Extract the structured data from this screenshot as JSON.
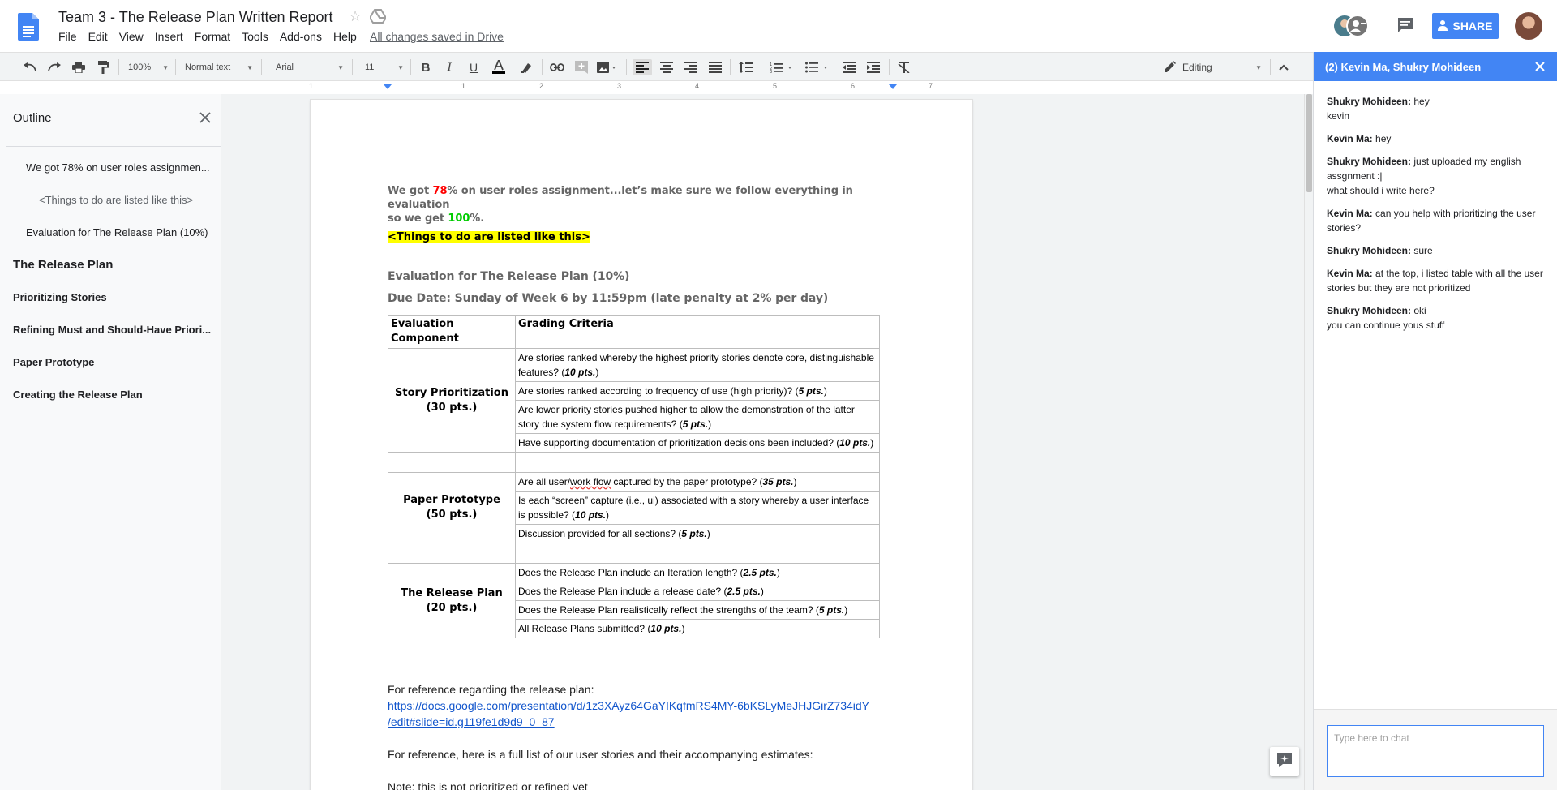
{
  "header": {
    "title": "Team 3 - The Release Plan Written Report",
    "menus": [
      "File",
      "Edit",
      "View",
      "Insert",
      "Format",
      "Tools",
      "Add-ons",
      "Help"
    ],
    "save_status": "All changes saved in Drive",
    "share_label": "SHARE"
  },
  "toolbar": {
    "zoom": "100%",
    "style": "Normal text",
    "font": "Arial",
    "font_size": "11",
    "mode": "Editing"
  },
  "ruler": {
    "numbers": [
      "1",
      "1",
      "2",
      "3",
      "4",
      "5",
      "6",
      "7"
    ]
  },
  "outline": {
    "title": "Outline",
    "items": [
      {
        "label": "We got 78% on user roles assignmen..."
      },
      {
        "label": "<Things to do are listed like this>"
      },
      {
        "label": "Evaluation for The Release Plan (10%)"
      },
      {
        "label": "The Release Plan"
      },
      {
        "label": "Prioritizing Stories"
      },
      {
        "label": "Refining Must and Should-Have Priori..."
      },
      {
        "label": "Paper Prototype"
      },
      {
        "label": "Creating the Release Plan"
      }
    ]
  },
  "document": {
    "intro": {
      "p1": "We got ",
      "num1": "78",
      "p2": "% on user roles assignment...let’s make sure we follow everything in evaluation",
      "p3": "so we get ",
      "num2": "100",
      "p4": "%."
    },
    "todo": "<Things to do are listed like this>",
    "eval_heading": "Evaluation for The Release Plan (10%)",
    "due_date": "Due Date: Sunday of Week 6 by 11:59pm (late penalty at 2% per day)",
    "table": {
      "col1": "Evaluation Component",
      "col2": "Grading Criteria",
      "sections": [
        {
          "component": "Story Prioritization",
          "points": "(30 pts.)",
          "criteria": [
            {
              "text": "Are stories ranked whereby the highest priority stories denote core, distinguishable features? (",
              "pts": "10 pts.",
              "end": ")"
            },
            {
              "text": "Are stories ranked according to frequency of use (high priority)? (",
              "pts": "5 pts.",
              "end": ")"
            },
            {
              "text": "Are lower priority stories pushed higher to allow the demonstration of the latter story due system flow requirements? (",
              "pts": "5 pts.",
              "end": ")"
            },
            {
              "text": "Have supporting documentation of prioritization decisions been included? (",
              "pts": "10 pts.",
              "end": ")"
            }
          ]
        },
        {
          "component": "Paper Prototype",
          "points": "(50 pts.)",
          "criteria": [
            {
              "text": "Are all user/work flow captured by the paper prototype? (",
              "pts": "35 pts.",
              "end": ")"
            },
            {
              "text": "Is each “screen” capture (i.e., ui) associated with a story whereby a user interface is possible? (",
              "pts": "10 pts.",
              "end": ")"
            },
            {
              "text": "Discussion provided for all sections? (",
              "pts": "5 pts.",
              "end": ")"
            }
          ]
        },
        {
          "component": "The Release Plan",
          "points": "(20 pts.)",
          "criteria": [
            {
              "text": "Does the Release Plan include an Iteration length? (",
              "pts": "2.5 pts.",
              "end": ")"
            },
            {
              "text": "Does the Release Plan include a release date? (",
              "pts": "2.5 pts.",
              "end": ")"
            },
            {
              "text": "Does the Release Plan realistically reflect the strengths of the team? (",
              "pts": "5 pts.",
              "end": ")"
            },
            {
              "text": "All Release Plans submitted? (",
              "pts": "10 pts.",
              "end": ")"
            }
          ]
        }
      ]
    },
    "reference_label": "For reference regarding the release plan:",
    "reference_link_1": "https://docs.google.com/presentation/d/1z3XAyz64GaYIKqfmRS4MY-6bKSLyMeJHJGirZ734idY",
    "reference_link_2": "/edit#slide=id.g119fe1d9d9_0_87",
    "stories_label": "For reference, here is a full list of our user stories and their accompanying estimates:",
    "note": "Note: this is not prioritized or refined yet"
  },
  "chat": {
    "header": "(2) Kevin Ma, Shukry Mohideen",
    "messages": [
      {
        "sender": "Shukry Mohideen:",
        "lines": [
          "hey",
          "kevin"
        ]
      },
      {
        "sender": "Kevin Ma:",
        "lines": [
          "hey"
        ]
      },
      {
        "sender": "Shukry Mohideen:",
        "lines": [
          "just uploaded my english assgnment :|",
          "what should i write here?"
        ]
      },
      {
        "sender": "Kevin Ma:",
        "lines": [
          "can you help with prioritizing the user stories?"
        ]
      },
      {
        "sender": "Shukry Mohideen:",
        "lines": [
          "sure"
        ]
      },
      {
        "sender": "Kevin Ma:",
        "lines": [
          "at the top, i listed table with all the user stories but they are not prioritized"
        ]
      },
      {
        "sender": "Shukry Mohideen:",
        "lines": [
          "oki",
          "you can continue yous stuff"
        ]
      }
    ],
    "input_placeholder": "Type here to chat"
  }
}
